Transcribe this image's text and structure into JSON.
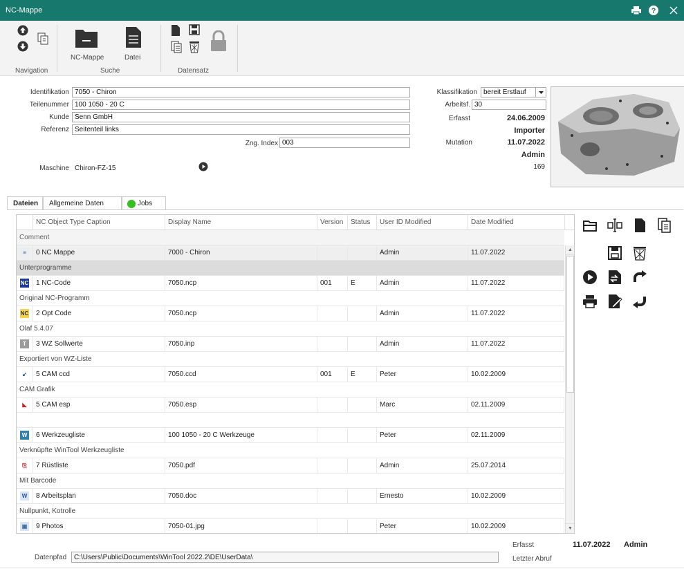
{
  "window": {
    "title": "NC-Mappe"
  },
  "ribbon": {
    "groups": {
      "navigation": "Navigation",
      "suche": "Suche",
      "datensatz": "Datensatz"
    },
    "buttons": {
      "nc_mappe": "NC-Mappe",
      "datei": "Datei"
    }
  },
  "form": {
    "labels": {
      "identifikation": "Identifikation",
      "teilenummer": "Teilenummer",
      "kunde": "Kunde",
      "referenz": "Referenz",
      "zng_index": "Zng. Index",
      "maschine": "Maschine",
      "klassifikation": "Klassifikation",
      "arbeitsf": "Arbeitsf.",
      "erfasst": "Erfasst",
      "mutation": "Mutation"
    },
    "values": {
      "identifikation": "7050 - Chiron",
      "teilenummer": "100 1050 - 20 C",
      "kunde": "Senn GmbH",
      "referenz": "Seitenteil links",
      "zng_index": "003",
      "maschine": "Chiron-FZ-15",
      "klassifikation": "bereit Erstlauf",
      "arbeitsf": "30",
      "erfasst_date": "24.06.2009",
      "erfasst_user": "Importer",
      "mutation_date": "11.07.2022",
      "mutation_user": "Admin",
      "mutation_count": "169"
    }
  },
  "tabs": [
    {
      "label": "Dateien"
    },
    {
      "label": "Allgemeine Daten"
    },
    {
      "label": "Jobs"
    }
  ],
  "grid": {
    "headers": {
      "type": "NC Object Type Caption",
      "display": "Display Name",
      "version": "Version",
      "status": "Status",
      "user": "User ID Modified",
      "date": "Date Modified",
      "comment": "Comment"
    },
    "rows": [
      {
        "type": "0 NC Mappe",
        "display": "7000 - Chiron",
        "version": "",
        "status": "",
        "user": "Admin",
        "date": "11.07.2022",
        "comment": "Unterprogramme",
        "icon": "nc-mappe-icon"
      },
      {
        "type": "1 NC-Code",
        "display": "7050.ncp",
        "version": "001",
        "status": "E",
        "user": "Admin",
        "date": "11.07.2022",
        "comment": "Original NC-Programm",
        "icon": "nc-code-icon"
      },
      {
        "type": "2 Opt Code",
        "display": "7050.ncp",
        "version": "",
        "status": "",
        "user": "Admin",
        "date": "11.07.2022",
        "comment": "Olaf 5.4.07",
        "icon": "opt-code-icon"
      },
      {
        "type": "3 WZ Sollwerte",
        "display": "7050.inp",
        "version": "",
        "status": "",
        "user": "Admin",
        "date": "11.07.2022",
        "comment": "Exportiert von WZ-Liste",
        "icon": "text-file-icon"
      },
      {
        "type": "5 CAM ccd",
        "display": "7050.ccd",
        "version": "001",
        "status": "E",
        "user": "Peter",
        "date": "10.02.2009",
        "comment": "CAM Grafik",
        "icon": "cam-ccd-icon"
      },
      {
        "type": "5 CAM esp",
        "display": "7050.esp",
        "version": "",
        "status": "",
        "user": "Marc",
        "date": "02.11.2009",
        "comment": "",
        "icon": "cam-esp-icon"
      },
      {
        "type": "6 Werkzeugliste",
        "display": "100 1050 - 20 C Werkzeuge",
        "version": "",
        "status": "",
        "user": "Peter",
        "date": "02.11.2009",
        "comment": "Verknüpfte WinTool Werkzeugliste",
        "icon": "wintool-icon"
      },
      {
        "type": "7 Rüstliste",
        "display": "7050.pdf",
        "version": "",
        "status": "",
        "user": "Admin",
        "date": "25.07.2014",
        "comment": "Mit Barcode",
        "icon": "pdf-icon"
      },
      {
        "type": "8 Arbeitsplan",
        "display": "7050.doc",
        "version": "",
        "status": "",
        "user": "Ernesto",
        "date": "10.02.2009",
        "comment": "Nullpunkt, Kotrolle",
        "icon": "word-doc-icon"
      },
      {
        "type": "9 Photos",
        "display": "7050-01.jpg",
        "version": "",
        "status": "",
        "user": "Peter",
        "date": "10.02.2009",
        "comment": "",
        "icon": "photo-icon"
      }
    ]
  },
  "footer": {
    "erfasst_label": "Erfasst",
    "erfasst_date": "11.07.2022",
    "erfasst_user": "Admin",
    "letzter_abruf_label": "Letzter Abruf",
    "datenpfad_label": "Datenpfad",
    "datenpfad": "C:\\Users\\Public\\Documents\\WinTool 2022.2\\DE\\UserData\\"
  },
  "colors": {
    "titlebar": "#17786d",
    "jobs_status": "#34c021",
    "selected_comment": "#dcdcdc"
  }
}
